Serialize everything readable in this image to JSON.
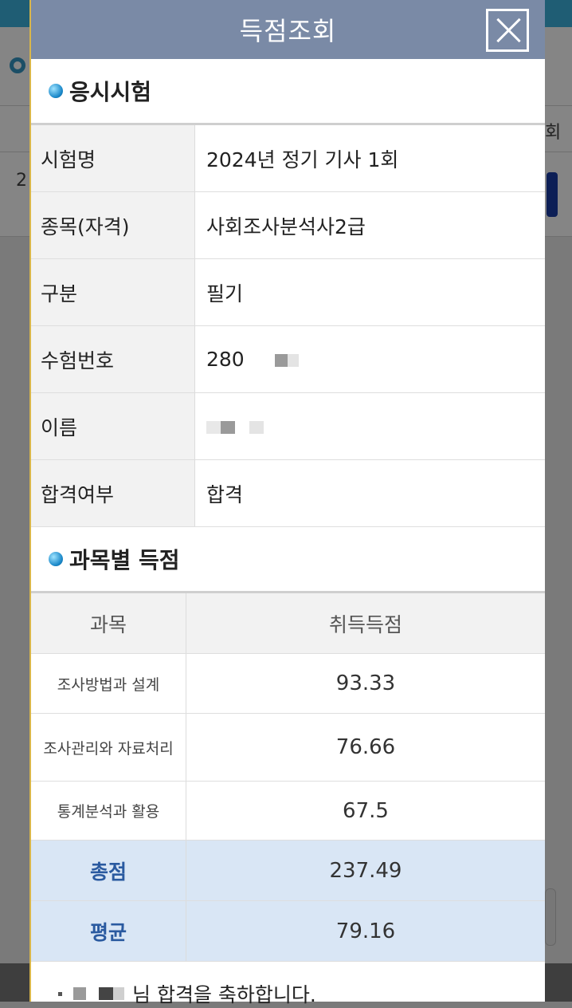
{
  "background": {
    "left_text": "2",
    "right_text": "회"
  },
  "modal": {
    "title": "득점조회"
  },
  "exam_section": {
    "title": "응시시험",
    "rows": [
      {
        "label": "시험명",
        "value": "2024년 정기 기사 1회"
      },
      {
        "label": "종목(자격)",
        "value": "사회조사분석사2급"
      },
      {
        "label": "구분",
        "value": "필기"
      },
      {
        "label": "수험번호",
        "value": "280"
      },
      {
        "label": "이름",
        "value": ""
      },
      {
        "label": "합격여부",
        "value": "합격"
      }
    ]
  },
  "score_section": {
    "title": "과목별 득점",
    "headers": {
      "subject": "과목",
      "score": "취득득점"
    },
    "subjects": [
      {
        "name": "조사방법과 설계",
        "score": "93.33"
      },
      {
        "name": "조사관리와 자료처리",
        "score": "76.66"
      },
      {
        "name": "통계분석과 활용",
        "score": "67.5"
      }
    ],
    "total": {
      "label": "총점",
      "score": "237.49"
    },
    "average": {
      "label": "평균",
      "score": "79.16"
    }
  },
  "congrats": {
    "text": "님 합격을 축하합니다."
  }
}
